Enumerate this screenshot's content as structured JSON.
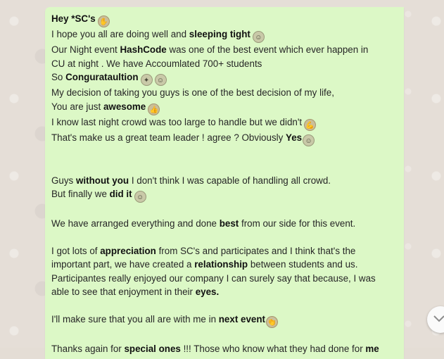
{
  "message": {
    "l1": {
      "a": "Hey *SC's"
    },
    "l2": {
      "a": "I hope you all are doing well and ",
      "b": "sleeping tight"
    },
    "l3": {
      "a": "Our Night event ",
      "b": "HashCode",
      "c": " was one of the best event which ever happen in"
    },
    "l4": {
      "a": "CU at night . We have Accoumlated 700+ students"
    },
    "l5": {
      "a": "So ",
      "b": "Congurataultion"
    },
    "l6": {
      "a": "My decision of taking  you guys is one of the best decision of my life,"
    },
    "l7": {
      "a": "You are just ",
      "b": "awesome"
    },
    "l8": {
      "a": "I know last night crowd was too large to handle but we didn't"
    },
    "l9": {
      "a": "That's make us a great team leader ! agree ? Obviously ",
      "b": "Yes"
    },
    "l10": {
      "a": "Guys ",
      "b": "without you",
      "c": " I don't think I was capable of handling all crowd."
    },
    "l11": {
      "a": "But finally we ",
      "b": "did it"
    },
    "l12": {
      "a": "We have arranged everything and done ",
      "b": "best",
      "c": " from our side for this event."
    },
    "l13": {
      "a": "I got lots of ",
      "b": "appreciation",
      "c": " from SC's and participates and I think that's the"
    },
    "l14": {
      "a": "important part, we have created a ",
      "b": "relationship",
      "c": " between students and us."
    },
    "l15": {
      "a": "Participantes really enjoyed our company I can surely say that because, I was"
    },
    "l16": {
      "a": "able to see that enjoyment in their ",
      "b": "eyes."
    },
    "l17": {
      "a": "I'll make sure that you all are with me in ",
      "b": "next event"
    },
    "l18": {
      "a": "Thanks again for ",
      "b": "special ones",
      "c": " !!! Those who know what they had done for ",
      "d": "me"
    }
  },
  "emoji": {
    "wave": "waving-hand-emoji",
    "grin": "grinning-face-emoji",
    "confetti": "confetti-emoji",
    "blush": "smiling-face-emoji",
    "thumbs": "thumbs-up-emoji",
    "muscle": "flexed-biceps-emoji",
    "clap": "clapping-hands-emoji"
  },
  "colors": {
    "bubble": "#dcf8c6",
    "wallpaper": "#e5ded7",
    "text": "#262626"
  },
  "icons": {
    "scroll_down": "chevron-down-icon"
  }
}
